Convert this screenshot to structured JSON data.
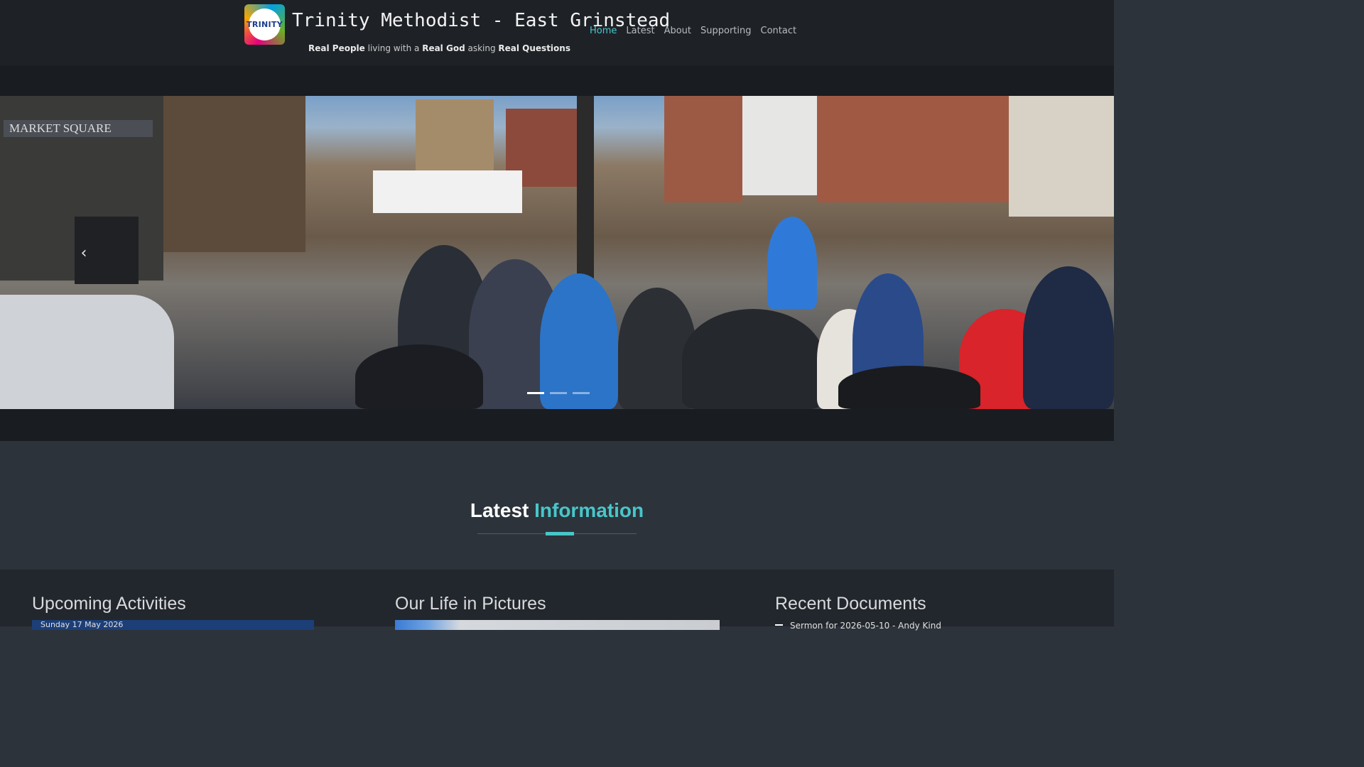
{
  "site": {
    "logo_text": "TRINITY",
    "title": "Trinity Methodist - East Grinstead",
    "tagline": {
      "p1_bold": "Real People",
      "p1": " living with a ",
      "p2_bold": "Real God",
      "p2": " asking ",
      "p3_bold": "Real Questions"
    }
  },
  "nav": {
    "items": [
      {
        "label": "Home",
        "active": true
      },
      {
        "label": "Latest",
        "active": false
      },
      {
        "label": "About",
        "active": false
      },
      {
        "label": "Supporting",
        "active": false
      },
      {
        "label": "Contact",
        "active": false
      }
    ]
  },
  "slider": {
    "prev_icon": "chevron-left-icon",
    "prev_glyph": "‹",
    "slide_count": 3,
    "active_index": 0,
    "sign_text": "MARKET SQUARE"
  },
  "latest": {
    "title_white": "Latest",
    "title_accent": "Information"
  },
  "columns": {
    "activities": {
      "heading": "Upcoming Activities",
      "first_item": "Sunday 17 May 2026"
    },
    "pictures": {
      "heading": "Our Life in Pictures"
    },
    "documents": {
      "heading": "Recent Documents",
      "first_item": "Sermon for 2026-05-10 - Andy Kind"
    }
  },
  "colors": {
    "accent": "#48c6c9",
    "header_bg": "#1e2227",
    "section_bg": "#2d333b",
    "activity_bar": "#1d3f78"
  }
}
